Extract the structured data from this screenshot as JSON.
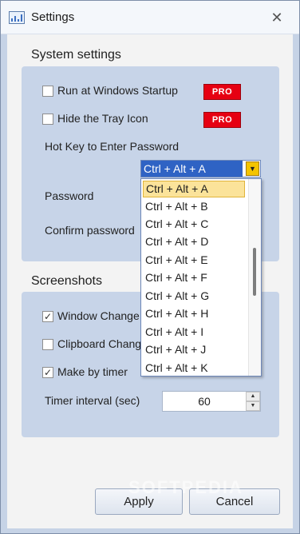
{
  "window": {
    "title": "Settings",
    "close_glyph": "✕"
  },
  "system_settings": {
    "group_title": "System settings",
    "run_at_startup": {
      "label": "Run at Windows Startup",
      "checked": false,
      "badge": "PRO"
    },
    "hide_tray_icon": {
      "label": "Hide the Tray Icon",
      "checked": false,
      "badge": "PRO"
    },
    "hotkey": {
      "label": "Hot Key to Enter Password",
      "selected": "Ctrl + Alt + A",
      "options": [
        "Ctrl + Alt + A",
        "Ctrl + Alt + B",
        "Ctrl + Alt + C",
        "Ctrl + Alt + D",
        "Ctrl + Alt + E",
        "Ctrl + Alt + F",
        "Ctrl + Alt + G",
        "Ctrl + Alt + H",
        "Ctrl + Alt + I",
        "Ctrl + Alt + J",
        "Ctrl + Alt + K"
      ]
    },
    "password_label": "Password",
    "confirm_password_label": "Confirm password"
  },
  "screenshots": {
    "group_title": "Screenshots",
    "window_change": {
      "label": "Window Change",
      "checked": true
    },
    "clipboard_change": {
      "label": "Clipboard Change",
      "checked": false
    },
    "make_by_timer": {
      "label": "Make by timer",
      "checked": true
    },
    "timer_interval": {
      "label": "Timer interval (sec)",
      "value": "60"
    }
  },
  "buttons": {
    "apply": "Apply",
    "cancel": "Cancel"
  },
  "watermark": "SOFTPEDIA",
  "icons": {
    "app": "chart-window-icon",
    "close": "close-icon",
    "check": "✓",
    "dropdown_arrow": "▼",
    "spin_up": "▲",
    "spin_down": "▼"
  }
}
